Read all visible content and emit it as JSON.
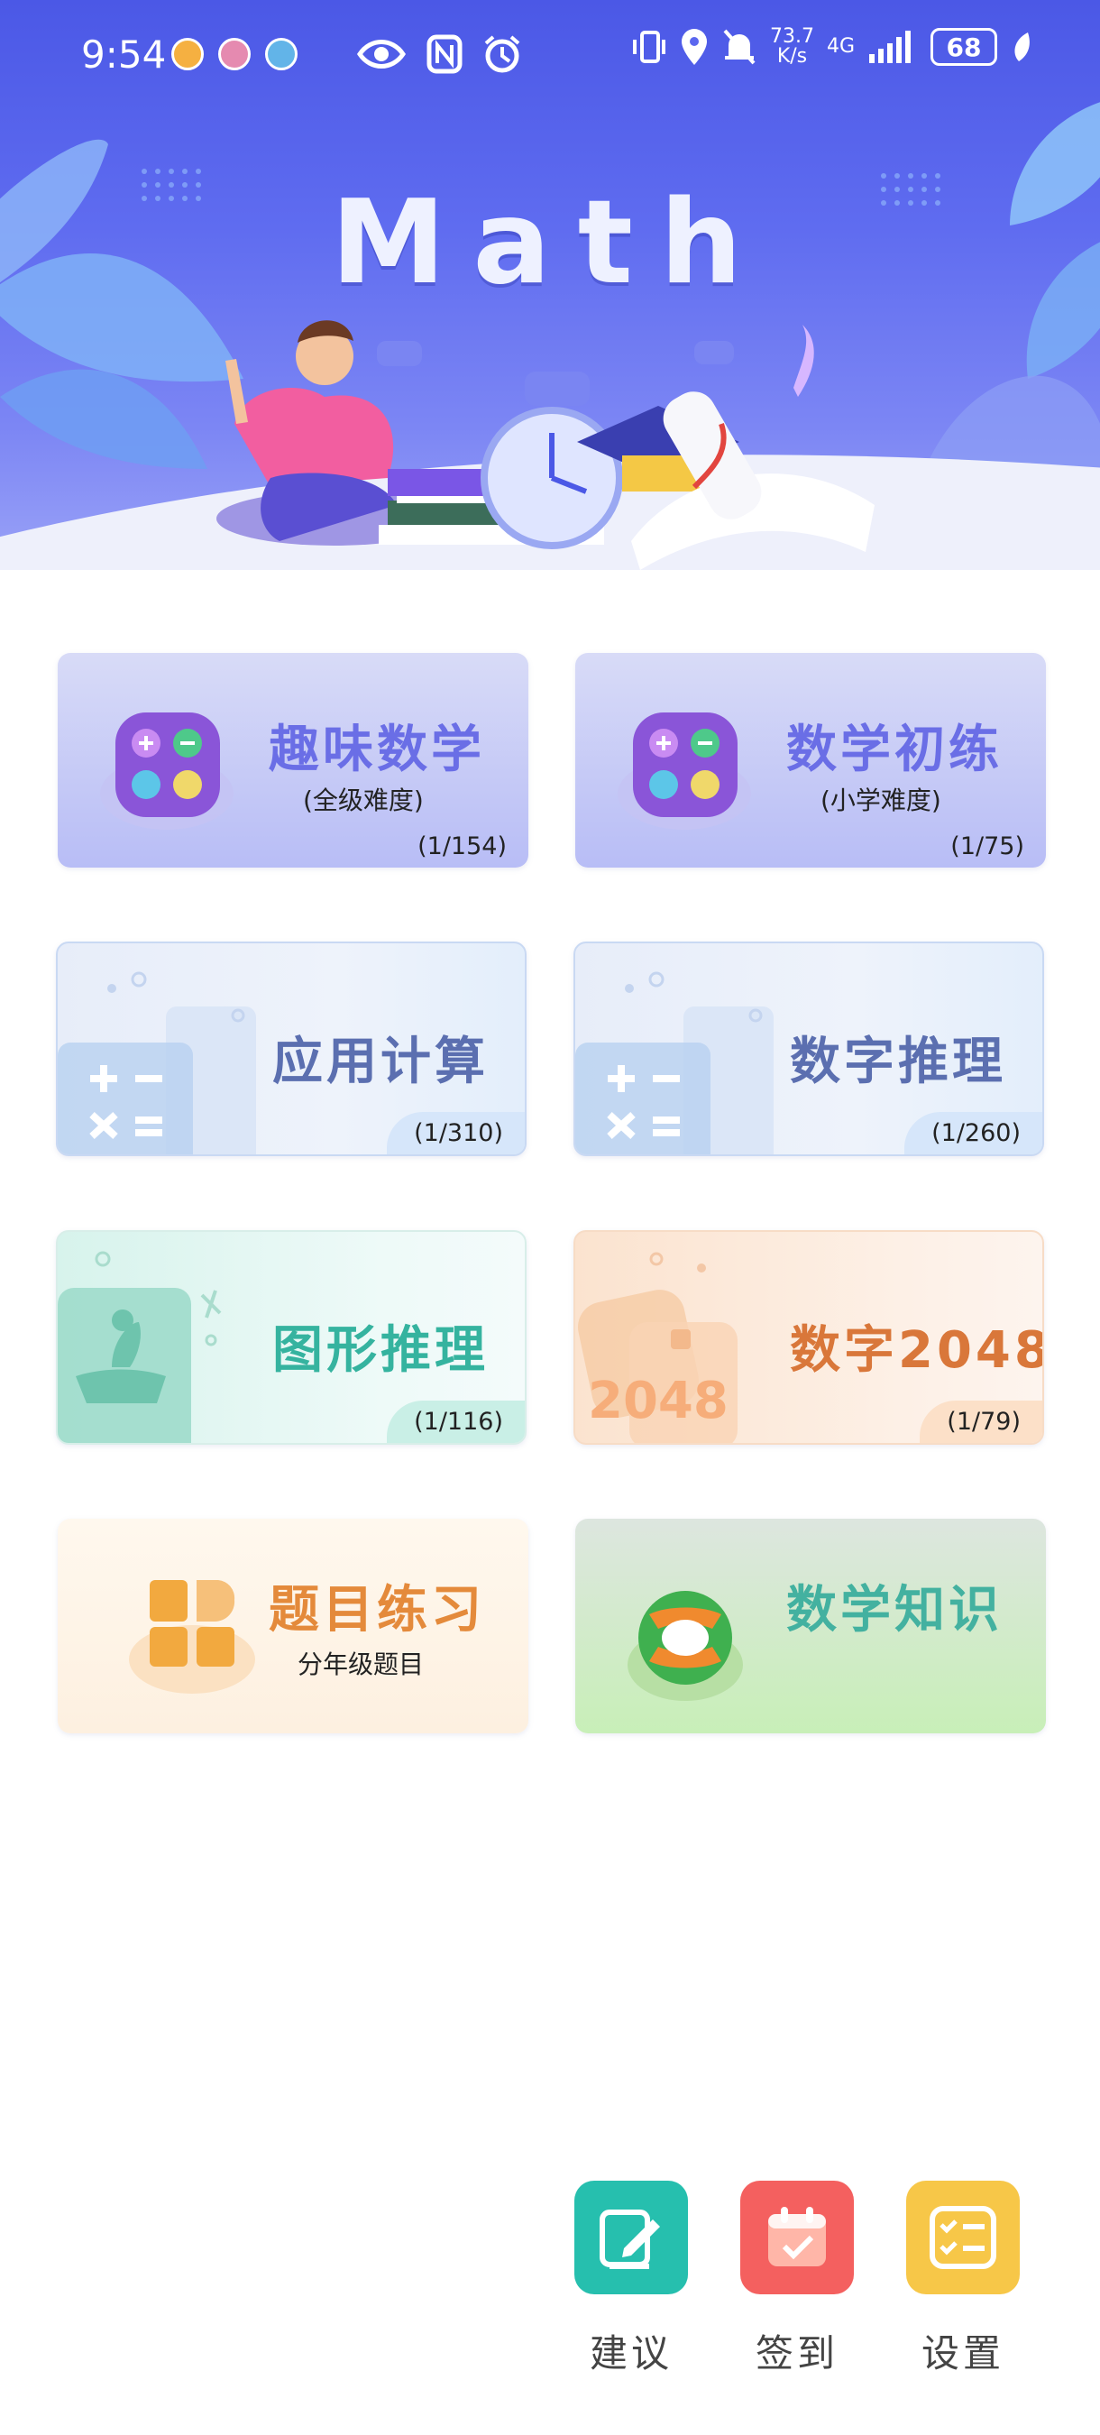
{
  "status_bar": {
    "time": "9:54",
    "net_speed": "73.7",
    "net_unit": "K/s",
    "network": "4G",
    "battery": "68",
    "icons": [
      "app-notification-icon",
      "eye-icon",
      "nfc-icon",
      "alarm-icon",
      "vibrate-icon",
      "location-icon",
      "mute-icon",
      "signal-icon",
      "battery-icon",
      "leaf-icon"
    ]
  },
  "hero": {
    "title": "Math"
  },
  "cards": [
    {
      "title": "趣味数学",
      "subtitle": "(全级难度)",
      "count": "(1/154)",
      "icon": "calculator-icon"
    },
    {
      "title": "数学初练",
      "subtitle": "(小学难度)",
      "count": "(1/75)",
      "icon": "calculator-icon"
    },
    {
      "title": "应用计算",
      "count": "(1/310)",
      "icon": "calculator-icon"
    },
    {
      "title": "数字推理",
      "count": "(1/260)",
      "icon": "calculator-icon"
    },
    {
      "title": "图形推理",
      "count": "(1/116)",
      "icon": "boat-icon"
    },
    {
      "title": "数字2048",
      "count": "(1/79)",
      "icon": "game-2048-icon",
      "deco_text": "2048"
    },
    {
      "title": "题目练习",
      "subtitle": "分年级题目",
      "icon": "grid-icon"
    },
    {
      "title": "数学知识",
      "icon": "globe-icon"
    }
  ],
  "actions": [
    {
      "label": "建议",
      "icon": "edit-icon",
      "color": "#26bfae"
    },
    {
      "label": "签到",
      "icon": "calendar-check-icon",
      "color": "#f4605f"
    },
    {
      "label": "设置",
      "icon": "checklist-icon",
      "color": "#f7c748"
    }
  ],
  "colors": {
    "hero_blue": "#5a67ef",
    "purple_title": "#6a6ee6",
    "blue_title": "#5b6fb0",
    "teal_title": "#35b39f",
    "orange_title": "#d9773a",
    "green_title": "#43b1a0"
  }
}
